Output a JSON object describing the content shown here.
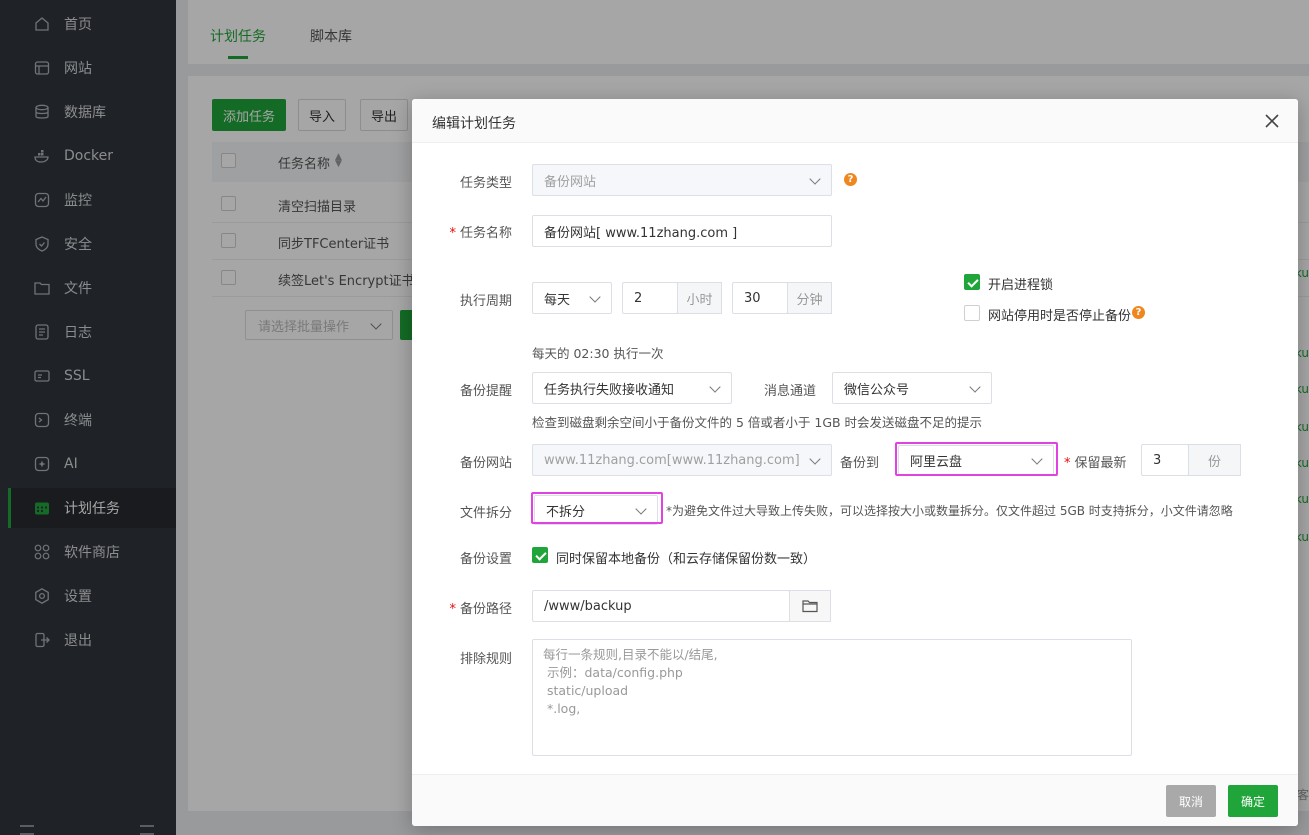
{
  "sidebar": {
    "items": [
      {
        "label": "首页",
        "icon": "home-icon"
      },
      {
        "label": "网站",
        "icon": "website-icon"
      },
      {
        "label": "数据库",
        "icon": "database-icon"
      },
      {
        "label": "Docker",
        "icon": "docker-icon"
      },
      {
        "label": "监控",
        "icon": "monitor-icon"
      },
      {
        "label": "安全",
        "icon": "shield-icon"
      },
      {
        "label": "文件",
        "icon": "folder-icon"
      },
      {
        "label": "日志",
        "icon": "log-icon"
      },
      {
        "label": "SSL",
        "icon": "ssl-icon"
      },
      {
        "label": "终端",
        "icon": "terminal-icon"
      },
      {
        "label": "AI",
        "icon": "ai-icon"
      },
      {
        "label": "计划任务",
        "icon": "calendar-icon",
        "active": true
      },
      {
        "label": "软件商店",
        "icon": "apps-icon"
      },
      {
        "label": "设置",
        "icon": "gear-icon"
      },
      {
        "label": "退出",
        "icon": "logout-icon"
      }
    ],
    "active_color": "#20a53a"
  },
  "page": {
    "tabs": [
      "计划任务",
      "脚本库"
    ],
    "toolbar": {
      "add_label": "添加任务",
      "import_label": "导入",
      "export_label": "导出"
    },
    "table": {
      "header_name": "任务名称",
      "rows": [
        "清空扫描目录",
        "同步TFCenter证书",
        "续签Let's Encrypt证书"
      ]
    },
    "batch_placeholder": "请选择批量操作",
    "right_peek": [
      "ku",
      "ku",
      "ku",
      "ku",
      "ku",
      "ku",
      "ku"
    ],
    "right_peek_last": "客"
  },
  "dialog": {
    "title": "编辑计划任务",
    "task_type": {
      "label": "任务类型",
      "value": "备份网站"
    },
    "task_name": {
      "label": "任务名称",
      "value": "备份网站[ www.11zhang.com ]"
    },
    "cycle": {
      "label": "执行周期",
      "period": "每天",
      "hour": "2",
      "hour_unit": "小时",
      "minute": "30",
      "minute_unit": "分钟",
      "summary": "每天的 02:30 执行一次"
    },
    "process_lock": {
      "label": "开启进程锁",
      "checked": true
    },
    "stop_backup": {
      "label": "网站停用时是否停止备份",
      "checked": false
    },
    "reminder": {
      "label": "备份提醒",
      "value": "任务执行失败接收通知",
      "channel_label": "消息通道",
      "channel_value": "微信公众号",
      "disk_hint": "检查到磁盘剩余空间小于备份文件的 5 倍或者小于 1GB 时会发送磁盘不足的提示"
    },
    "backup_site": {
      "label": "备份网站",
      "value": "www.11zhang.com[www.11zhang.com]",
      "to_label": "备份到",
      "to_value": "阿里云盘",
      "keep_label": "保留最新",
      "keep_value": "3",
      "keep_unit": "份"
    },
    "split": {
      "label": "文件拆分",
      "value": "不拆分",
      "hint": "*为避免文件过大导致上传失败，可以选择按大小或数量拆分。仅文件超过 5GB 时支持拆分，小文件请忽略"
    },
    "backup_setting": {
      "label": "备份设置",
      "option": "同时保留本地备份（和云存储保留份数一致）",
      "checked": true
    },
    "backup_path": {
      "label": "备份路径",
      "value": "/www/backup"
    },
    "exclude": {
      "label": "排除规则",
      "placeholder": "每行一条规则,目录不能以/结尾,\n 示例：data/config.php\n static/upload\n *.log,"
    },
    "cancel_label": "取消",
    "ok_label": "确定"
  },
  "colors": {
    "accent": "#20a53a",
    "highlight": "#e342e3",
    "help": "#f0861e"
  }
}
